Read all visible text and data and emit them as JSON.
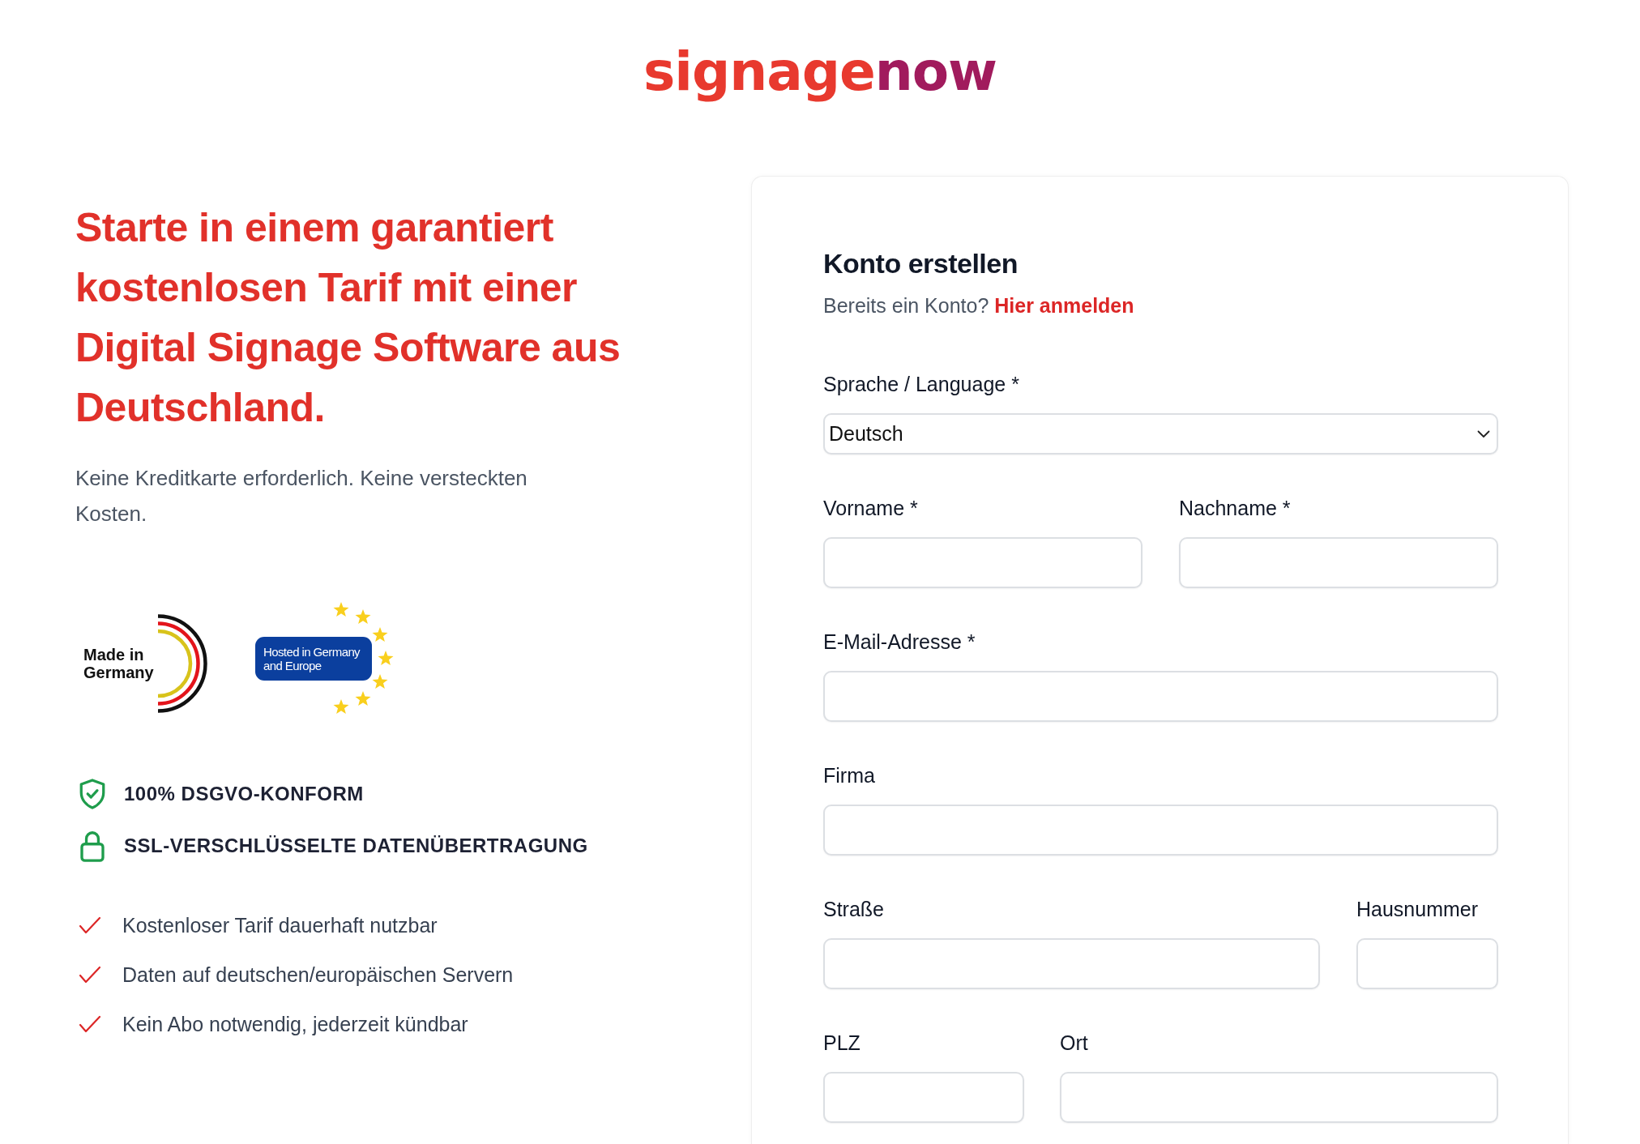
{
  "logo": {
    "parts": [
      "signage",
      "now"
    ]
  },
  "hero": {
    "headline": "Starte in einem garantiert kostenlosen Tarif mit einer Digital Signage Software aus Deutschland.",
    "subtitle": "Keine Kreditkarte erforderlich. Keine versteckten Kosten.",
    "badges": [
      {
        "kind": "made_in",
        "text": "Made in Germany"
      },
      {
        "kind": "hosted",
        "text": "Hosted in Germany and Europe"
      }
    ],
    "trust_items": [
      {
        "kind": "shield",
        "text": "100% DSGVO-KONFORM"
      },
      {
        "kind": "lock",
        "text": "SSL-VERSCHLÜSSELTE DATENÜBERTRAGUNG"
      }
    ],
    "benefits": [
      "Kostenloser Tarif dauerhaft nutzbar",
      "Daten auf deutschen/europäischen Servern",
      "Kein Abo notwendig, jederzeit kündbar"
    ]
  },
  "form": {
    "title": "Konto erstellen",
    "login_prompt": "Bereits ein Konto?",
    "login_link": "Hier anmelden",
    "rows": [
      {
        "fields": [
          {
            "label": "Sprache / Language *",
            "kind": "select",
            "value": "Deutsch"
          }
        ]
      },
      {
        "fields": [
          {
            "label": "Vorname *",
            "kind": "text"
          },
          {
            "label": "Nachname *",
            "kind": "text"
          }
        ]
      },
      {
        "fields": [
          {
            "label": "E-Mail-Adresse *",
            "kind": "text"
          }
        ]
      },
      {
        "fields": [
          {
            "label": "Firma",
            "kind": "text"
          }
        ]
      },
      {
        "fields": [
          {
            "label": "Straße",
            "kind": "text"
          },
          {
            "label": "Hausnummer",
            "kind": "text"
          }
        ]
      },
      {
        "fields": [
          {
            "label": "PLZ",
            "kind": "text"
          },
          {
            "label": "Ort",
            "kind": "text"
          }
        ]
      }
    ]
  }
}
